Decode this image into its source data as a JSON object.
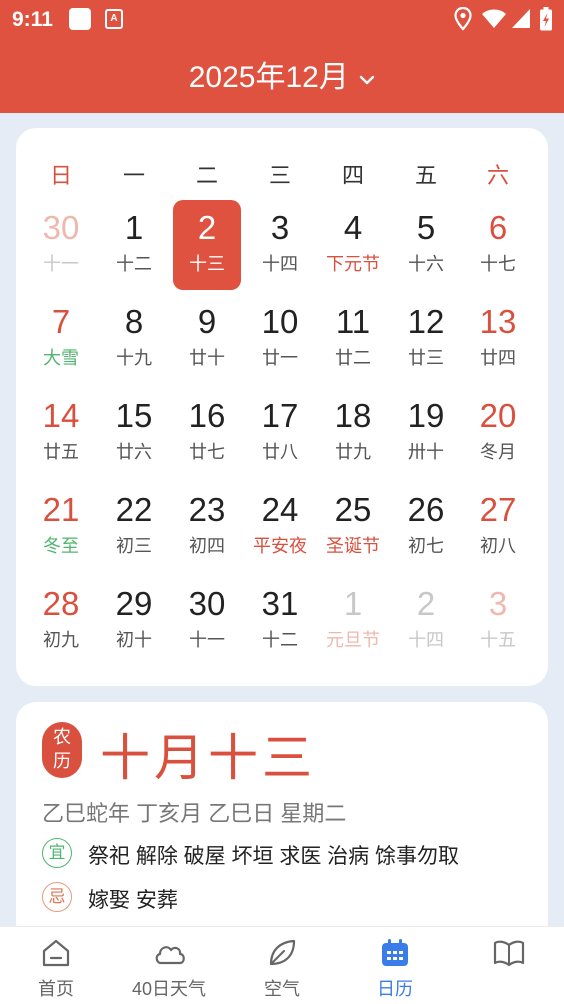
{
  "status_bar": {
    "time": "9:11",
    "app_icon_letter": "A"
  },
  "header": {
    "title": "2025年12月"
  },
  "weekdays": [
    "日",
    "一",
    "二",
    "三",
    "四",
    "五",
    "六"
  ],
  "calendar": {
    "selected_day": "2",
    "rows": [
      [
        [
          "30",
          "十一"
        ],
        [
          "1",
          "十二"
        ],
        [
          "2",
          "十三"
        ],
        [
          "3",
          "十四"
        ],
        [
          "4",
          "下元节"
        ],
        [
          "5",
          "十六"
        ],
        [
          "6",
          "十七"
        ]
      ],
      [
        [
          "7",
          "大雪"
        ],
        [
          "8",
          "十九"
        ],
        [
          "9",
          "廿十"
        ],
        [
          "10",
          "廿一"
        ],
        [
          "11",
          "廿二"
        ],
        [
          "12",
          "廿三"
        ],
        [
          "13",
          "廿四"
        ]
      ],
      [
        [
          "14",
          "廿五"
        ],
        [
          "15",
          "廿六"
        ],
        [
          "16",
          "廿七"
        ],
        [
          "17",
          "廿八"
        ],
        [
          "18",
          "廿九"
        ],
        [
          "19",
          "卅十"
        ],
        [
          "20",
          "冬月"
        ]
      ],
      [
        [
          "21",
          "冬至"
        ],
        [
          "22",
          "初三"
        ],
        [
          "23",
          "初四"
        ],
        [
          "24",
          "平安夜"
        ],
        [
          "25",
          "圣诞节"
        ],
        [
          "26",
          "初七"
        ],
        [
          "27",
          "初八"
        ]
      ],
      [
        [
          "28",
          "初九"
        ],
        [
          "29",
          "初十"
        ],
        [
          "30",
          "十一"
        ],
        [
          "31",
          "十二"
        ],
        [
          "1",
          "元旦节"
        ],
        [
          "2",
          "十四"
        ],
        [
          "3",
          "十五"
        ]
      ]
    ]
  },
  "lunar_info": {
    "badge": [
      "农",
      "历"
    ],
    "lunar_date": "十月十三",
    "ganzhi": "乙巳蛇年 丁亥月 乙巳日 星期二",
    "yi_label": "宜",
    "yi": "祭祀 解除 破屋 坏垣 求医 治病 馀事勿取",
    "ji_label": "忌",
    "ji": "嫁娶 安葬"
  },
  "bottom_nav": [
    {
      "label": "首页",
      "icon": "home-icon"
    },
    {
      "label": "40日天气",
      "icon": "cloud-icon"
    },
    {
      "label": "空气",
      "icon": "leaf-icon"
    },
    {
      "label": "日历",
      "icon": "calendar-icon",
      "active": true
    },
    {
      "label": "",
      "icon": "book-icon"
    }
  ],
  "colors": {
    "accent": "#e05240",
    "solar_term": "#52b56f",
    "active_tab": "#3b7de8",
    "background": "#e5ecf5"
  }
}
